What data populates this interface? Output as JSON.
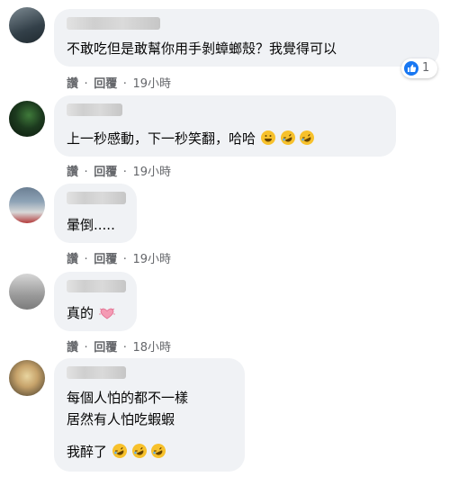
{
  "labels": {
    "like": "讚",
    "reply": "回覆",
    "dot": "·"
  },
  "reaction": {
    "icon": "like-icon",
    "count": "1"
  },
  "comments": [
    {
      "lines": [
        "不敢吃但是敢幫你用手剝蟑螂殼？我覺得可以"
      ],
      "time": "19小時"
    },
    {
      "lines": [
        "上一秒感動，下一秒笑翻，哈哈"
      ],
      "emojis": [
        "grinning-face-icon",
        "rolling-laughing-icon",
        "rolling-laughing-icon"
      ],
      "time": "19小時"
    },
    {
      "lines": [
        "暈倒....."
      ],
      "time": "19小時"
    },
    {
      "lines": [
        "真的"
      ],
      "emojis": [
        "heart-sticker-icon"
      ],
      "time": "18小時"
    },
    {
      "lines": [
        "每個人怕的都不一樣",
        "居然有人怕吃蝦蝦",
        "我醉了"
      ],
      "emojis": [
        "rolling-laughing-icon",
        "rolling-laughing-icon",
        "rolling-laughing-icon"
      ],
      "time": ""
    }
  ]
}
